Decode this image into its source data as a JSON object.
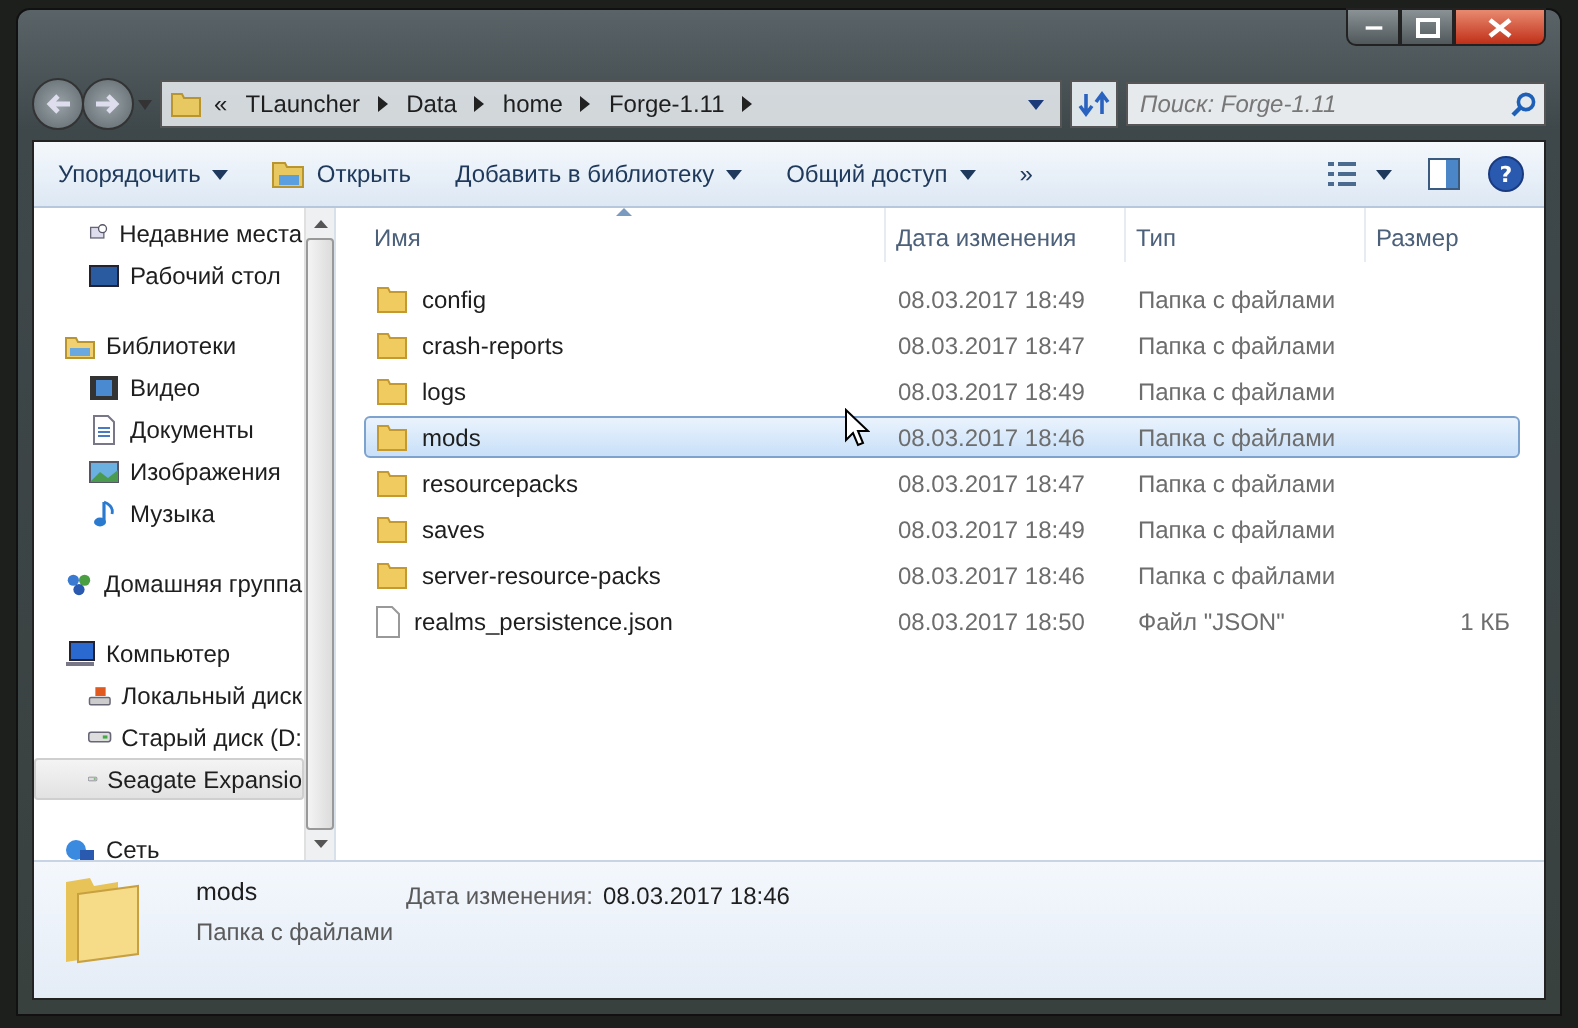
{
  "address": {
    "overflow": "«",
    "crumbs": [
      "TLauncher",
      "Data",
      "home",
      "Forge-1.11"
    ]
  },
  "search": {
    "placeholder": "Поиск: Forge-1.11"
  },
  "toolbar": {
    "buttons": [
      {
        "label": "Упорядочить",
        "kind": "dropdown"
      },
      {
        "label": "Открыть",
        "kind": "open"
      },
      {
        "label": "Добавить в библиотеку",
        "kind": "dropdown"
      },
      {
        "label": "Общий доступ",
        "kind": "dropdown"
      },
      {
        "label": "»",
        "kind": "more"
      }
    ],
    "help": "?"
  },
  "sidebar": {
    "items": [
      {
        "children": [
          {
            "label": "Недавние места",
            "selected": false
          },
          {
            "label": "Рабочий стол",
            "selected": false
          }
        ]
      },
      {
        "label": "Библиотеки",
        "selected": false,
        "children": [
          {
            "label": "Видео",
            "selected": false
          },
          {
            "label": "Документы",
            "selected": false
          },
          {
            "label": "Изображения",
            "selected": false
          },
          {
            "label": "Музыка",
            "selected": false
          }
        ]
      },
      {
        "label": "Домашняя группа",
        "selected": false
      },
      {
        "label": "Компьютер",
        "selected": false,
        "children": [
          {
            "label": "Локальный диск",
            "selected": false
          },
          {
            "label": "Старый диск (D:",
            "selected": false
          },
          {
            "label": "Seagate Expansio",
            "selected": true
          }
        ]
      },
      {
        "label": "Сеть",
        "selected": false
      }
    ]
  },
  "table": {
    "columns": [
      {
        "label": "Имя",
        "sorted": true
      },
      {
        "label": "Дата изменения",
        "sorted": false
      },
      {
        "label": "Тип",
        "sorted": false
      },
      {
        "label": "Размер",
        "sorted": false
      }
    ],
    "rows": [
      {
        "kind": "folder",
        "name": "config",
        "date": "08.03.2017 18:49",
        "type": "Папка с файлами",
        "selected": false
      },
      {
        "kind": "folder",
        "name": "crash-reports",
        "date": "08.03.2017 18:47",
        "type": "Папка с файлами",
        "selected": false
      },
      {
        "kind": "folder",
        "name": "logs",
        "date": "08.03.2017 18:49",
        "type": "Папка с файлами",
        "selected": false
      },
      {
        "kind": "folder",
        "name": "mods",
        "date": "08.03.2017 18:46",
        "type": "Папка с файлами",
        "selected": true
      },
      {
        "kind": "folder",
        "name": "resourcepacks",
        "date": "08.03.2017 18:47",
        "type": "Папка с файлами",
        "selected": false
      },
      {
        "kind": "folder",
        "name": "saves",
        "date": "08.03.2017 18:49",
        "type": "Папка с файлами",
        "selected": false
      },
      {
        "kind": "folder",
        "name": "server-resource-packs",
        "date": "08.03.2017 18:46",
        "type": "Папка с файлами",
        "selected": false
      },
      {
        "kind": "file",
        "name": "realms_persistence.json",
        "date": "08.03.2017 18:50",
        "type": "Файл \"JSON\"",
        "size": "1 КБ",
        "selected": false
      }
    ]
  },
  "details": {
    "name": "mods",
    "type": "Папка с файлами",
    "date_label": "Дата изменения:",
    "date": "08.03.2017 18:46"
  }
}
